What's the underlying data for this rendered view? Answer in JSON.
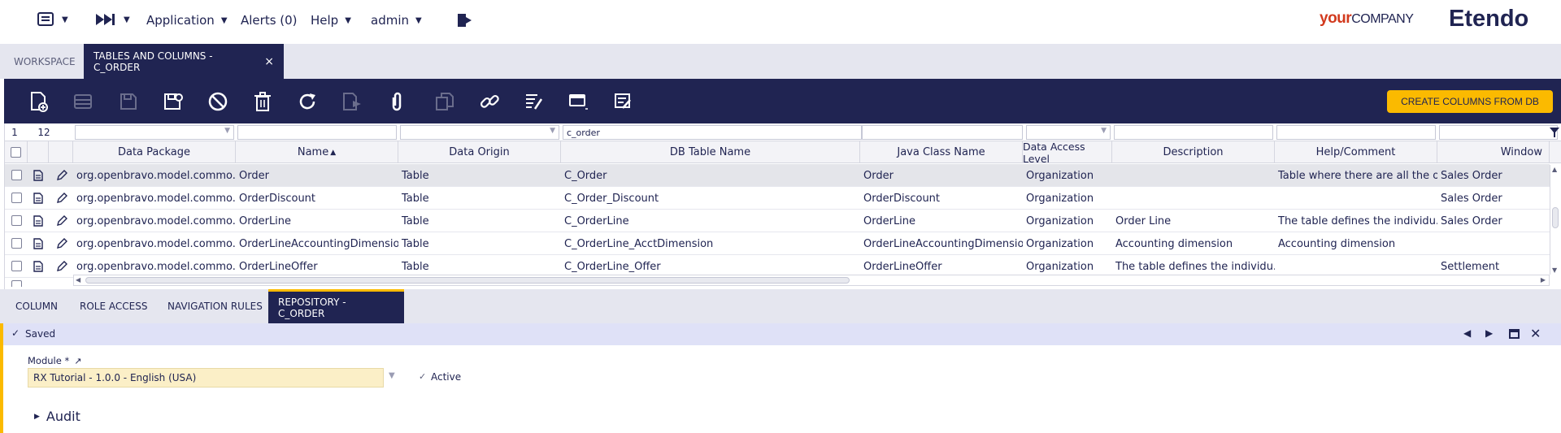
{
  "nav": {
    "application": "Application",
    "alerts": "Alerts (0)",
    "help": "Help",
    "user": "admin",
    "brand_your": "your",
    "brand_company": "COMPANY",
    "brand_etendo": "Etendo"
  },
  "tabs": {
    "workspace": "WORKSPACE",
    "current": "TABLES AND COLUMNS - C_ORDER",
    "close": "×"
  },
  "toolbar": {
    "create_columns": "CREATE COLUMNS FROM DB"
  },
  "grid": {
    "row_num": "1",
    "count": "12",
    "filter_dbtable": "c_order",
    "columns": [
      "Data Package",
      "Name",
      "Data Origin",
      "DB Table Name",
      "Java Class Name",
      "Data Access Level",
      "Description",
      "Help/Comment",
      "Window"
    ],
    "sort_indicator": "▲",
    "rows": [
      {
        "pkg": "org.openbravo.model.commo...",
        "name": "Order",
        "origin": "Table",
        "db": "C_Order",
        "java": "Order",
        "access": "Organization",
        "desc": "",
        "help": "Table where there are all the o...",
        "window": "Sales Order"
      },
      {
        "pkg": "org.openbravo.model.commo...",
        "name": "OrderDiscount",
        "origin": "Table",
        "db": "C_Order_Discount",
        "java": "OrderDiscount",
        "access": "Organization",
        "desc": "",
        "help": "",
        "window": "Sales Order"
      },
      {
        "pkg": "org.openbravo.model.commo...",
        "name": "OrderLine",
        "origin": "Table",
        "db": "C_OrderLine",
        "java": "OrderLine",
        "access": "Organization",
        "desc": "Order Line",
        "help": "The table defines the individu...",
        "window": "Sales Order"
      },
      {
        "pkg": "org.openbravo.model.commo...",
        "name": "OrderLineAccountingDimension",
        "origin": "Table",
        "db": "C_OrderLine_AcctDimension",
        "java": "OrderLineAccountingDimension",
        "access": "Organization",
        "desc": "Accounting dimension",
        "help": "Accounting dimension",
        "window": ""
      },
      {
        "pkg": "org.openbravo.model.commo...",
        "name": "OrderLineOffer",
        "origin": "Table",
        "db": "C_OrderLine_Offer",
        "java": "OrderLineOffer",
        "access": "Organization",
        "desc": "The table defines the individu...",
        "help": "",
        "window": "Settlement"
      }
    ]
  },
  "subtabs": [
    "COLUMN",
    "ROLE ACCESS",
    "NAVIGATION RULES",
    "REPOSITORY - C_ORDER"
  ],
  "status": {
    "text": "Saved"
  },
  "form": {
    "module_label": "Module *",
    "module_value": "RX Tutorial - 1.0.0 - English (USA)",
    "active_label": "Active",
    "audit_label": "Audit"
  },
  "colors": {
    "navy": "#202452",
    "accent": "#fbba00",
    "brand_red": "#d23a1e"
  }
}
